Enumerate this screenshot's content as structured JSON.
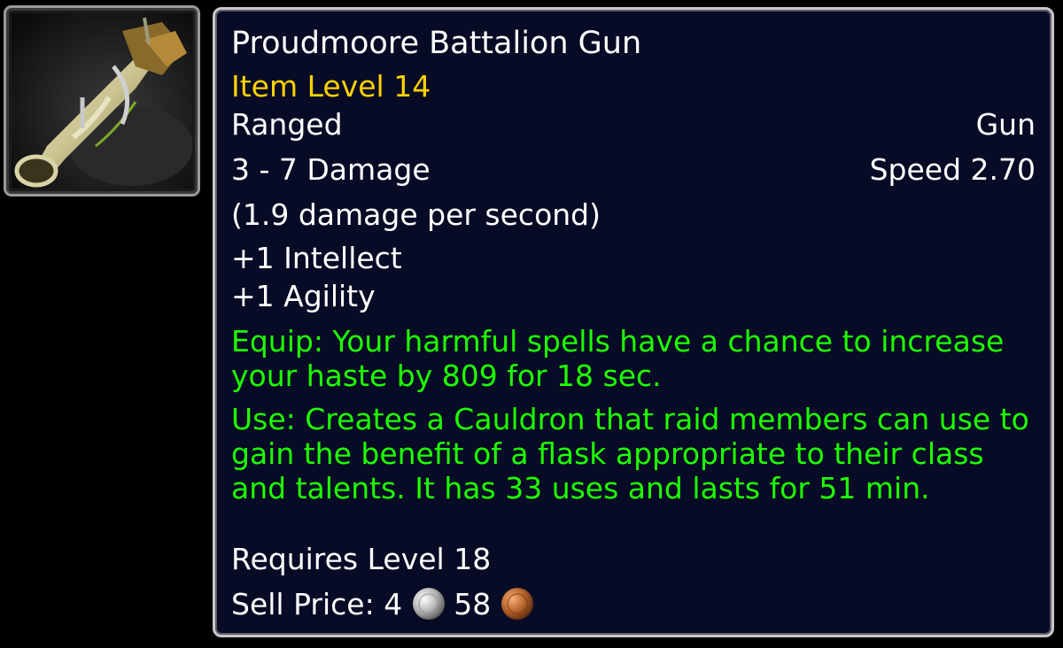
{
  "item": {
    "name": "Proudmoore Battalion Gun",
    "item_level": "Item Level 14",
    "slot": "Ranged",
    "type": "Gun",
    "damage": "3 - 7 Damage",
    "speed": "Speed 2.70",
    "dps": "(1.9 damage per second)",
    "stats": [
      "+1 Intellect",
      "+1 Agility"
    ],
    "equip": "Equip: Your harmful spells have a chance to increase your haste by 809 for 18 sec.",
    "use": "Use: Creates a Cauldron that raid members can use to gain the benefit of a flask appropriate to their class and talents. It has 33 uses and lasts for 51 min.",
    "requires": "Requires Level 18",
    "sell_label": "Sell Price:",
    "sell_silver": "4",
    "sell_copper": "58"
  },
  "icons": {
    "item_icon": "gun-icon",
    "silver": "silver-coin-icon",
    "copper": "copper-coin-icon"
  },
  "colors": {
    "item_name": "#ffffff",
    "item_level": "#ffd200",
    "effect_text": "#1eff00",
    "tooltip_bg": "#080b25"
  }
}
